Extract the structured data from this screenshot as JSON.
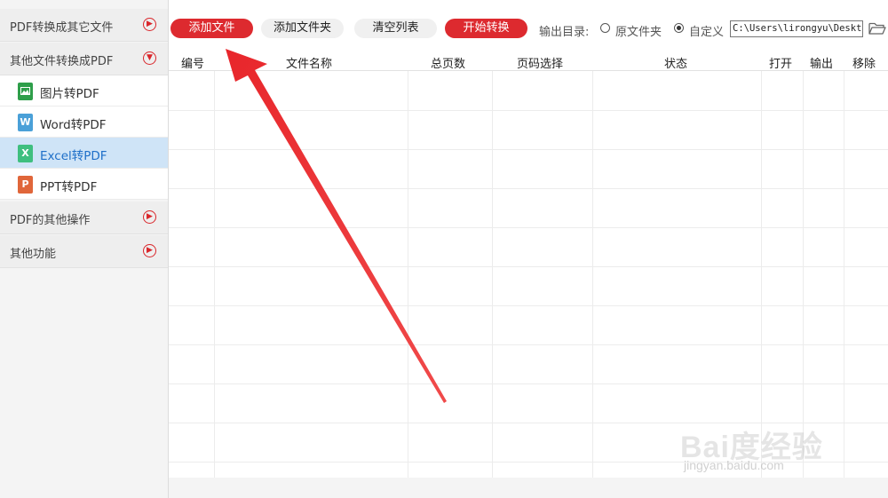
{
  "sidebar": {
    "groups": [
      {
        "label": "PDF转换成其它文件",
        "state": "collapsed"
      },
      {
        "label": "其他文件转换成PDF",
        "state": "expanded"
      },
      {
        "label": "PDF的其他操作",
        "state": "collapsed"
      },
      {
        "label": "其他功能",
        "state": "collapsed"
      }
    ],
    "items": [
      {
        "label": "图片转PDF",
        "icon": "image-file-icon",
        "color": "#2e9e4a"
      },
      {
        "label": "Word转PDF",
        "icon": "word-file-icon",
        "icon_text": "W",
        "color": "#4aa0d8"
      },
      {
        "label": "Excel转PDF",
        "icon": "excel-file-icon",
        "icon_text": "X",
        "color": "#3fbf7f",
        "active": true
      },
      {
        "label": "PPT转PDF",
        "icon": "ppt-file-icon",
        "icon_text": "P",
        "color": "#e0663a"
      }
    ]
  },
  "toolbar": {
    "add_file": "添加文件",
    "add_folder": "添加文件夹",
    "clear_list": "清空列表",
    "start_convert": "开始转换",
    "output_dir_label": "输出目录:",
    "option_original": "原文件夹",
    "option_custom": "自定义",
    "selected_option": "自定义",
    "output_path": "C:\\Users\\lirongyu\\Desktop"
  },
  "table": {
    "columns": [
      "编号",
      "文件名称",
      "总页数",
      "页码选择",
      "状态",
      "打开",
      "输出",
      "移除"
    ],
    "rows": []
  },
  "watermark": {
    "logo": "Bai度经验",
    "url": "jingyan.baidu.com"
  },
  "colors": {
    "accent_red": "#dd2a2f",
    "active_item_bg": "#cfe4f7",
    "active_item_text": "#1e6fc8"
  }
}
